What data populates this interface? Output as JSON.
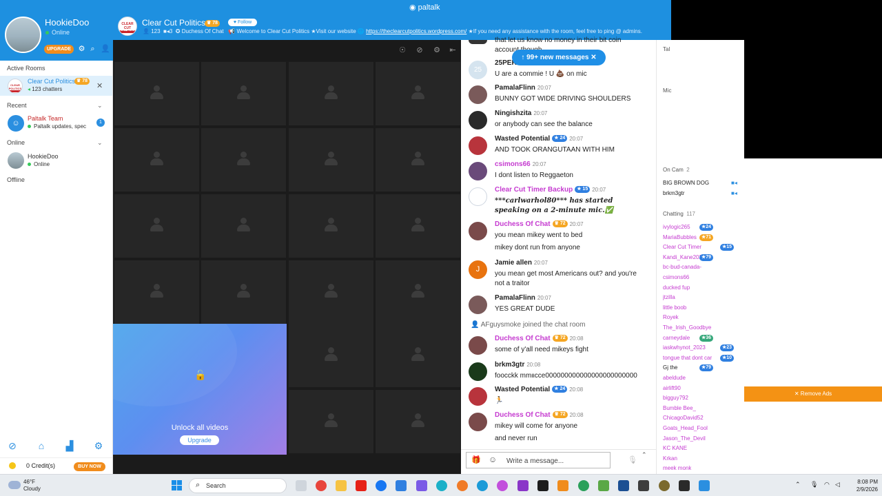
{
  "brand": "paltalk",
  "user": {
    "name": "HookieDoo",
    "status": "Online",
    "upgrade": "UPGRADE"
  },
  "sidebar": {
    "active_rooms_label": "Active Rooms",
    "active_room": {
      "name": "Clear Cut Politics",
      "badge": "78",
      "chatters": "123 chatters"
    },
    "recent_label": "Recent",
    "recent_item": {
      "name": "Paltalk Team",
      "preview": "Paltalk updates, spec",
      "count": "1"
    },
    "online_label": "Online",
    "online_item": {
      "name": "HookieDoo",
      "status": "Online"
    },
    "offline_label": "Offline",
    "credits": "0 Credit(s)",
    "buy_now": "BUY NOW"
  },
  "room": {
    "title": "Clear Cut Politics",
    "badge": "78",
    "follow": "Follow",
    "users_count": "123",
    "cams_count": "3",
    "owner": "Duchess Of Chat",
    "welcome": "Welcome to Clear Cut Politics ★Visit our website",
    "url": "https://theclearcutpolitics.wordpress.com/",
    "assist": "★If you need any assistance with the room, feel free to ping @ admins."
  },
  "video": {
    "unlock_text": "Unlock all videos",
    "upgrade_btn": "Upgrade"
  },
  "chat": {
    "new_messages": "99+ new messages",
    "partial_top": "that let us know no money in their bit coin account though",
    "messages": [
      {
        "name": "25PERCENT",
        "time": "",
        "text": "U are a commie ! U 💩 on mic",
        "color": "#222222"
      },
      {
        "name": "PamalaFlinn",
        "time": "20:07",
        "text": "BUNNY GOT WIDE DRIVING SHOULDERS",
        "color": "#222222"
      },
      {
        "name": "Ningishzita",
        "time": "20:07",
        "text": "or anybody can see the balance",
        "color": "#222222"
      },
      {
        "name": "Wasted Potential",
        "time": "20:07",
        "badge": "24",
        "text": "AND TOOK ORANGUTAAN WITH HIM",
        "color": "#222222"
      },
      {
        "name": "csimons66",
        "time": "20:07",
        "text": "I dont listen to Reggaeton",
        "color": "#c53bd0"
      },
      {
        "name": "Clear Cut Timer Backup",
        "time": "20:07",
        "badge": "15",
        "text": "***carlwarhol80*** has started speaking on a 2-minute mic.✅",
        "color": "#c53bd0"
      },
      {
        "name": "Duchess Of Chat",
        "time": "20:07",
        "badge": "72",
        "text": "you mean mikey went to bed",
        "text2": "mikey dont run from anyone",
        "color": "#c53bd0"
      },
      {
        "name": "Jamie allen",
        "time": "20:07",
        "text": "you mean get most Americans out? and you're not a traitor",
        "color": "#222222"
      },
      {
        "name": "PamalaFlinn",
        "time": "20:07",
        "text": "YES GREAT DUDE",
        "color": "#222222"
      },
      {
        "name": "Duchess Of Chat",
        "time": "20:08",
        "badge": "72",
        "text": "some of y'all need mikeys fight",
        "color": "#c53bd0"
      },
      {
        "name": "brkm3gtr",
        "time": "20:08",
        "text": "foocckk mmιιcce000000000000000000000000",
        "color": "#222222"
      },
      {
        "name": "Wasted Potential",
        "time": "20:08",
        "badge": "24",
        "text": "🏃",
        "color": "#222222"
      },
      {
        "name": "Duchess Of Chat",
        "time": "20:08",
        "badge": "72",
        "text": "mikey will come for anyone",
        "text2": "and never run",
        "color": "#c53bd0"
      }
    ],
    "system": "AFguysmoke joined the chat room",
    "placeholder": "Write a message..."
  },
  "users_panel": {
    "tab": "Tal",
    "mic_label": "Mic",
    "on_cam_label": "On Cam",
    "on_cam_count": "2",
    "on_cam": [
      "BIG BROWN DOG",
      "brkm3gtr"
    ],
    "chatting_label": "Chatting",
    "chatting_count": "117",
    "chatting": [
      {
        "name": "ivylogic265",
        "color": "pink",
        "badge": "24"
      },
      {
        "name": "MariaBubbles",
        "color": "pink",
        "badge": "71"
      },
      {
        "name": "Clear Cut Timer",
        "color": "pink",
        "badge": "15"
      },
      {
        "name": "Kandi_Kane2026",
        "color": "pink",
        "badge": "79"
      },
      {
        "name": "bc-bud-canada-",
        "color": "pink"
      },
      {
        "name": "csimons66",
        "color": "pink"
      },
      {
        "name": "ducked fup",
        "color": "pink"
      },
      {
        "name": "jtzilla",
        "color": "pink"
      },
      {
        "name": "little boob",
        "color": "pink"
      },
      {
        "name": "Royek",
        "color": "pink"
      },
      {
        "name": "The_Irish_Goodbye",
        "color": "pink"
      },
      {
        "name": "carneydale",
        "color": "pink",
        "badge": "36"
      },
      {
        "name": "iaskwhynot_2023",
        "color": "pink",
        "badge": "23"
      },
      {
        "name": "tongue that dont car",
        "color": "pink",
        "badge": "10"
      },
      {
        "name": "Gj the",
        "color": "black",
        "badge": "79"
      },
      {
        "name": "abeldude",
        "color": "pink"
      },
      {
        "name": "airlift90",
        "color": "pink"
      },
      {
        "name": "bigguy792",
        "color": "pink"
      },
      {
        "name": "Bumble Bee_",
        "color": "pink"
      },
      {
        "name": "ChicagoDavid52",
        "color": "pink"
      },
      {
        "name": "Goats_Head_Fool",
        "color": "pink"
      },
      {
        "name": "Jason_The_Devil",
        "color": "pink"
      },
      {
        "name": "KC KANE",
        "color": "pink"
      },
      {
        "name": "Krkan",
        "color": "pink"
      },
      {
        "name": "meek monk",
        "color": "pink"
      }
    ],
    "remove_ads": "✕ Remove Ads"
  },
  "taskbar": {
    "weather_temp": "46°F",
    "weather_desc": "Cloudy",
    "search": "Search",
    "time": "8:08 PM",
    "date": "2/9/2026"
  }
}
